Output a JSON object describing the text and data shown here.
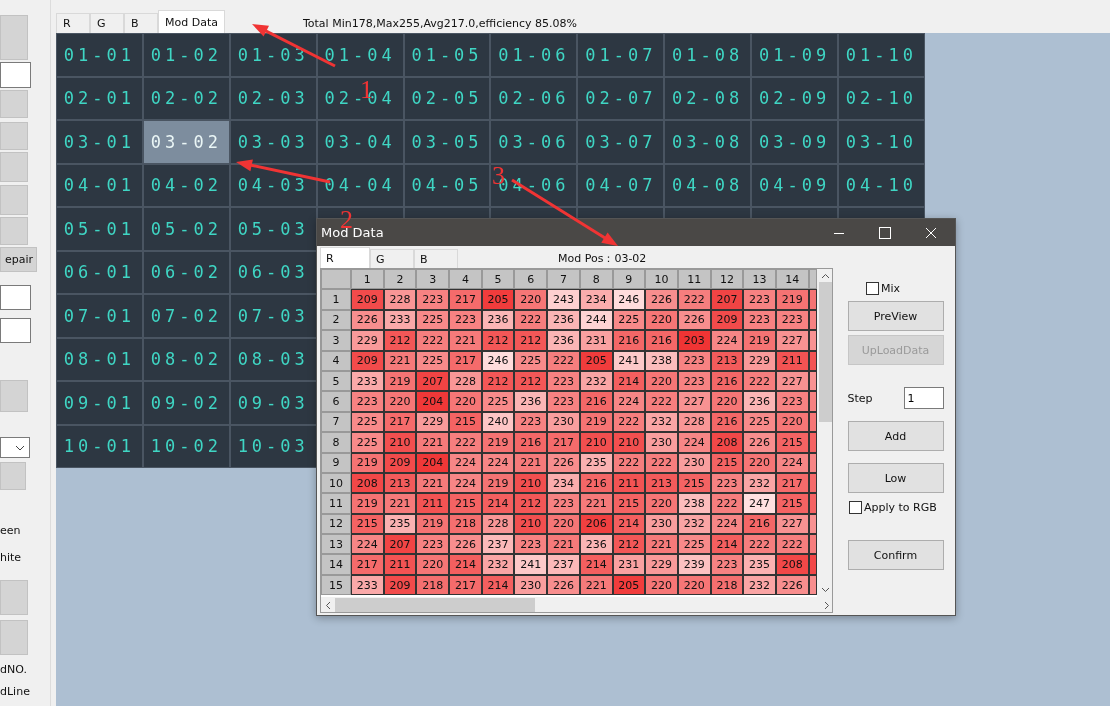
{
  "left_panel": {
    "items": [
      {
        "kind": "button"
      },
      {
        "kind": "input"
      },
      {
        "kind": "button"
      },
      {
        "kind": "button"
      },
      {
        "kind": "button"
      },
      {
        "kind": "button"
      },
      {
        "kind": "button"
      },
      {
        "kind": "button",
        "label": "epair"
      },
      {
        "kind": "input"
      },
      {
        "kind": "input"
      },
      {
        "kind": "button"
      },
      {
        "kind": "dropdown"
      },
      {
        "kind": "button"
      },
      {
        "kind": "text",
        "label": "een"
      },
      {
        "kind": "text",
        "label": "hite"
      },
      {
        "kind": "button"
      },
      {
        "kind": "button"
      },
      {
        "kind": "text",
        "label": "dNO."
      },
      {
        "kind": "text",
        "label": "dLine"
      }
    ]
  },
  "tabs": [
    {
      "label": "R",
      "selected": false
    },
    {
      "label": "G",
      "selected": false
    },
    {
      "label": "B",
      "selected": false
    },
    {
      "label": "Mod Data",
      "selected": true
    }
  ],
  "summary": "Total Min178,Max255,Avg217.0,efficiency 85.08%",
  "grid": {
    "rows": [
      {
        "cells": [
          {
            "label": "01-01",
            "selected": false
          },
          {
            "label": "01-02",
            "selected": false
          },
          {
            "label": "01-03",
            "selected": false
          },
          {
            "label": "01-04",
            "selected": false
          },
          {
            "label": "01-05",
            "selected": false
          },
          {
            "label": "01-06",
            "selected": false
          },
          {
            "label": "01-07",
            "selected": false
          },
          {
            "label": "01-08",
            "selected": false
          },
          {
            "label": "01-09",
            "selected": false
          },
          {
            "label": "01-10",
            "selected": false
          }
        ]
      },
      {
        "cells": [
          {
            "label": "02-01",
            "selected": false
          },
          {
            "label": "02-02",
            "selected": false
          },
          {
            "label": "02-03",
            "selected": false
          },
          {
            "label": "02-04",
            "selected": false
          },
          {
            "label": "02-05",
            "selected": false
          },
          {
            "label": "02-06",
            "selected": false
          },
          {
            "label": "02-07",
            "selected": false
          },
          {
            "label": "02-08",
            "selected": false
          },
          {
            "label": "02-09",
            "selected": false
          },
          {
            "label": "02-10",
            "selected": false
          }
        ]
      },
      {
        "cells": [
          {
            "label": "03-01",
            "selected": false
          },
          {
            "label": "03-02",
            "selected": true
          },
          {
            "label": "03-03",
            "selected": false
          },
          {
            "label": "03-04",
            "selected": false
          },
          {
            "label": "03-05",
            "selected": false
          },
          {
            "label": "03-06",
            "selected": false
          },
          {
            "label": "03-07",
            "selected": false
          },
          {
            "label": "03-08",
            "selected": false
          },
          {
            "label": "03-09",
            "selected": false
          },
          {
            "label": "03-10",
            "selected": false
          }
        ]
      },
      {
        "cells": [
          {
            "label": "04-01",
            "selected": false
          },
          {
            "label": "04-02",
            "selected": false
          },
          {
            "label": "04-03",
            "selected": false
          },
          {
            "label": "04-04",
            "selected": false
          },
          {
            "label": "04-05",
            "selected": false
          },
          {
            "label": "04-06",
            "selected": false
          },
          {
            "label": "04-07",
            "selected": false
          },
          {
            "label": "04-08",
            "selected": false
          },
          {
            "label": "04-09",
            "selected": false
          },
          {
            "label": "04-10",
            "selected": false
          }
        ]
      },
      {
        "cells": [
          {
            "label": "05-01",
            "selected": false
          },
          {
            "label": "05-02",
            "selected": false
          },
          {
            "label": "05-03",
            "selected": false
          }
        ]
      },
      {
        "cells": [
          {
            "label": "06-01",
            "selected": false
          },
          {
            "label": "06-02",
            "selected": false
          },
          {
            "label": "06-03",
            "selected": false
          }
        ]
      },
      {
        "cells": [
          {
            "label": "07-01",
            "selected": false
          },
          {
            "label": "07-02",
            "selected": false
          },
          {
            "label": "07-03",
            "selected": false
          }
        ]
      },
      {
        "cells": [
          {
            "label": "08-01",
            "selected": false
          },
          {
            "label": "08-02",
            "selected": false
          },
          {
            "label": "08-03",
            "selected": false
          }
        ]
      },
      {
        "cells": [
          {
            "label": "09-01",
            "selected": false
          },
          {
            "label": "09-02",
            "selected": false
          },
          {
            "label": "09-03",
            "selected": false
          }
        ]
      },
      {
        "cells": [
          {
            "label": "10-01",
            "selected": false
          },
          {
            "label": "10-02",
            "selected": false
          },
          {
            "label": "10-03",
            "selected": false
          }
        ]
      }
    ]
  },
  "dialog": {
    "title": "Mod Data",
    "tabs": [
      {
        "label": "R",
        "selected": true
      },
      {
        "label": "G",
        "selected": false
      },
      {
        "label": "B",
        "selected": false
      }
    ],
    "position_label": "Mod Pos：",
    "position_value": "03-02",
    "table": {
      "columns": [
        "1",
        "2",
        "3",
        "4",
        "5",
        "6",
        "7",
        "8",
        "9",
        "10",
        "11",
        "12",
        "13",
        "14"
      ],
      "rows": [
        {
          "header": "1",
          "values": [
            "209",
            "228",
            "223",
            "217",
            "205",
            "220",
            "243",
            "234",
            "246",
            "226",
            "222",
            "207",
            "223",
            "219"
          ]
        },
        {
          "header": "2",
          "values": [
            "226",
            "233",
            "225",
            "223",
            "236",
            "222",
            "236",
            "244",
            "225",
            "220",
            "226",
            "209",
            "223",
            "223"
          ]
        },
        {
          "header": "3",
          "values": [
            "229",
            "212",
            "222",
            "221",
            "212",
            "212",
            "236",
            "231",
            "216",
            "216",
            "203",
            "224",
            "219",
            "227"
          ]
        },
        {
          "header": "4",
          "values": [
            "209",
            "221",
            "225",
            "217",
            "246",
            "225",
            "222",
            "205",
            "241",
            "238",
            "223",
            "213",
            "229",
            "211"
          ]
        },
        {
          "header": "5",
          "values": [
            "233",
            "219",
            "207",
            "228",
            "212",
            "212",
            "223",
            "232",
            "214",
            "220",
            "223",
            "216",
            "222",
            "227"
          ]
        },
        {
          "header": "6",
          "values": [
            "223",
            "220",
            "204",
            "220",
            "225",
            "236",
            "223",
            "216",
            "224",
            "222",
            "227",
            "220",
            "236",
            "223"
          ]
        },
        {
          "header": "7",
          "values": [
            "225",
            "217",
            "229",
            "215",
            "240",
            "223",
            "230",
            "219",
            "222",
            "232",
            "228",
            "216",
            "225",
            "220"
          ]
        },
        {
          "header": "8",
          "values": [
            "225",
            "210",
            "221",
            "222",
            "219",
            "216",
            "217",
            "210",
            "210",
            "230",
            "224",
            "208",
            "226",
            "215"
          ]
        },
        {
          "header": "9",
          "values": [
            "219",
            "209",
            "204",
            "224",
            "224",
            "221",
            "226",
            "235",
            "222",
            "222",
            "230",
            "215",
            "220",
            "224"
          ]
        },
        {
          "header": "10",
          "values": [
            "208",
            "213",
            "221",
            "224",
            "219",
            "210",
            "234",
            "216",
            "211",
            "213",
            "215",
            "223",
            "232",
            "217"
          ]
        },
        {
          "header": "11",
          "values": [
            "219",
            "221",
            "211",
            "215",
            "214",
            "212",
            "223",
            "221",
            "215",
            "220",
            "238",
            "222",
            "247",
            "215"
          ]
        },
        {
          "header": "12",
          "values": [
            "215",
            "235",
            "219",
            "218",
            "228",
            "210",
            "220",
            "206",
            "214",
            "230",
            "232",
            "224",
            "216",
            "227"
          ]
        },
        {
          "header": "13",
          "values": [
            "224",
            "207",
            "223",
            "226",
            "237",
            "223",
            "221",
            "236",
            "212",
            "221",
            "225",
            "214",
            "222",
            "222"
          ]
        },
        {
          "header": "14",
          "values": [
            "217",
            "211",
            "220",
            "214",
            "232",
            "241",
            "237",
            "214",
            "231",
            "229",
            "239",
            "223",
            "235",
            "208"
          ]
        },
        {
          "header": "15",
          "values": [
            "233",
            "209",
            "218",
            "217",
            "214",
            "230",
            "226",
            "221",
            "205",
            "220",
            "220",
            "218",
            "232",
            "226"
          ]
        }
      ]
    },
    "mix": {
      "label": "Mix",
      "checked": false
    },
    "buttons": [
      {
        "label": "PreView",
        "disabled": false
      },
      {
        "label": "UpLoadData",
        "disabled": true
      }
    ],
    "step": {
      "label": "Step",
      "value": "1"
    },
    "adjust_buttons": [
      {
        "label": "Add"
      },
      {
        "label": "Low"
      }
    ],
    "apply_rgb": {
      "label": "Apply to RGB",
      "checked": false
    },
    "confirm": {
      "label": "Confirm"
    }
  },
  "annotations": [
    {
      "label": "1"
    },
    {
      "label": "2"
    },
    {
      "label": "3"
    }
  ]
}
